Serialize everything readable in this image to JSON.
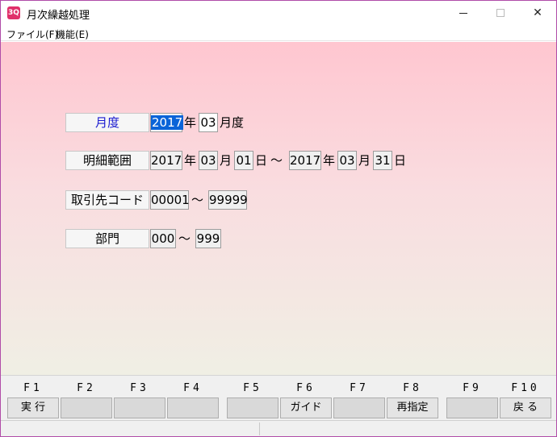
{
  "window": {
    "icon_text": "3Q",
    "title": "月次繰越処理"
  },
  "menu": {
    "file": "ファイル(F)",
    "functions": "機能(E)"
  },
  "form": {
    "month_row": {
      "label": "月度",
      "year": "2017",
      "year_unit": "年",
      "month": "03",
      "month_unit": "月度"
    },
    "detail_range": {
      "label": "明細範囲",
      "from_year": "2017",
      "from_year_unit": "年",
      "from_month": "03",
      "from_month_unit": "月",
      "from_day": "01",
      "from_day_unit": "日",
      "tilde": "～",
      "to_year": "2017",
      "to_year_unit": "年",
      "to_month": "03",
      "to_month_unit": "月",
      "to_day": "31",
      "to_day_unit": "日"
    },
    "customer_code": {
      "label": "取引先コード",
      "from": "00001",
      "tilde": "～",
      "to": "99999"
    },
    "department": {
      "label": "部門",
      "from": "000",
      "tilde": "～",
      "to": "999"
    }
  },
  "function_keys": [
    {
      "key": "F1",
      "label": "実 行"
    },
    {
      "key": "F2",
      "label": ""
    },
    {
      "key": "F3",
      "label": ""
    },
    {
      "key": "F4",
      "label": ""
    },
    {
      "key": "F5",
      "label": ""
    },
    {
      "key": "F6",
      "label": "ガイド"
    },
    {
      "key": "F7",
      "label": ""
    },
    {
      "key": "F8",
      "label": "再指定"
    },
    {
      "key": "F9",
      "label": ""
    },
    {
      "key": "F10",
      "label": "戻 る"
    }
  ]
}
